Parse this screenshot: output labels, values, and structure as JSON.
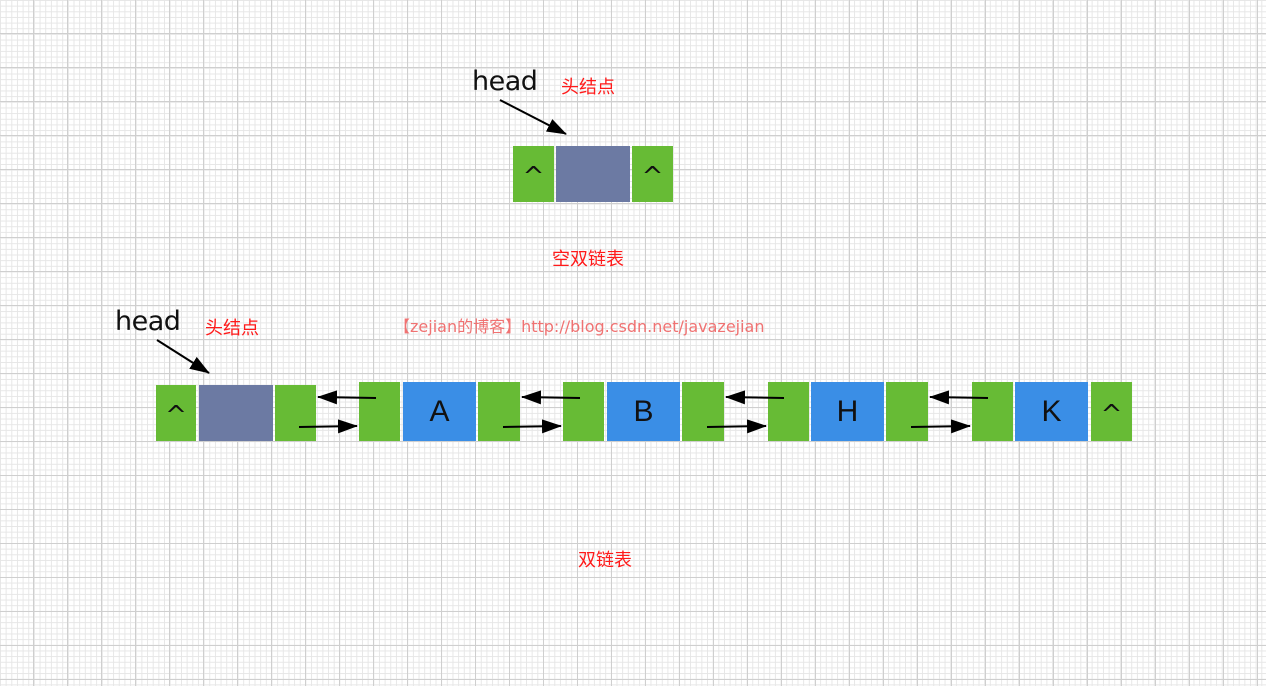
{
  "empty_list": {
    "head_label": "head",
    "head_node_label": "头结点",
    "prev_null": "^",
    "next_null": "^",
    "caption": "空双链表"
  },
  "list": {
    "head_label": "head",
    "head_node_label": "头结点",
    "head_prev_null": "^",
    "nodes": [
      {
        "value": "A"
      },
      {
        "value": "B"
      },
      {
        "value": "H"
      },
      {
        "value": "K"
      }
    ],
    "tail_next_null": "^",
    "caption": "双链表"
  },
  "watermark": "【zejian的博客】http://blog.csdn.net/javazejian",
  "colors": {
    "pointer_field": "#67bb35",
    "head_data": "#6c7aa3",
    "node_data": "#3a8ee6",
    "label_red": "#ff1a1a",
    "watermark": "#f07272"
  }
}
